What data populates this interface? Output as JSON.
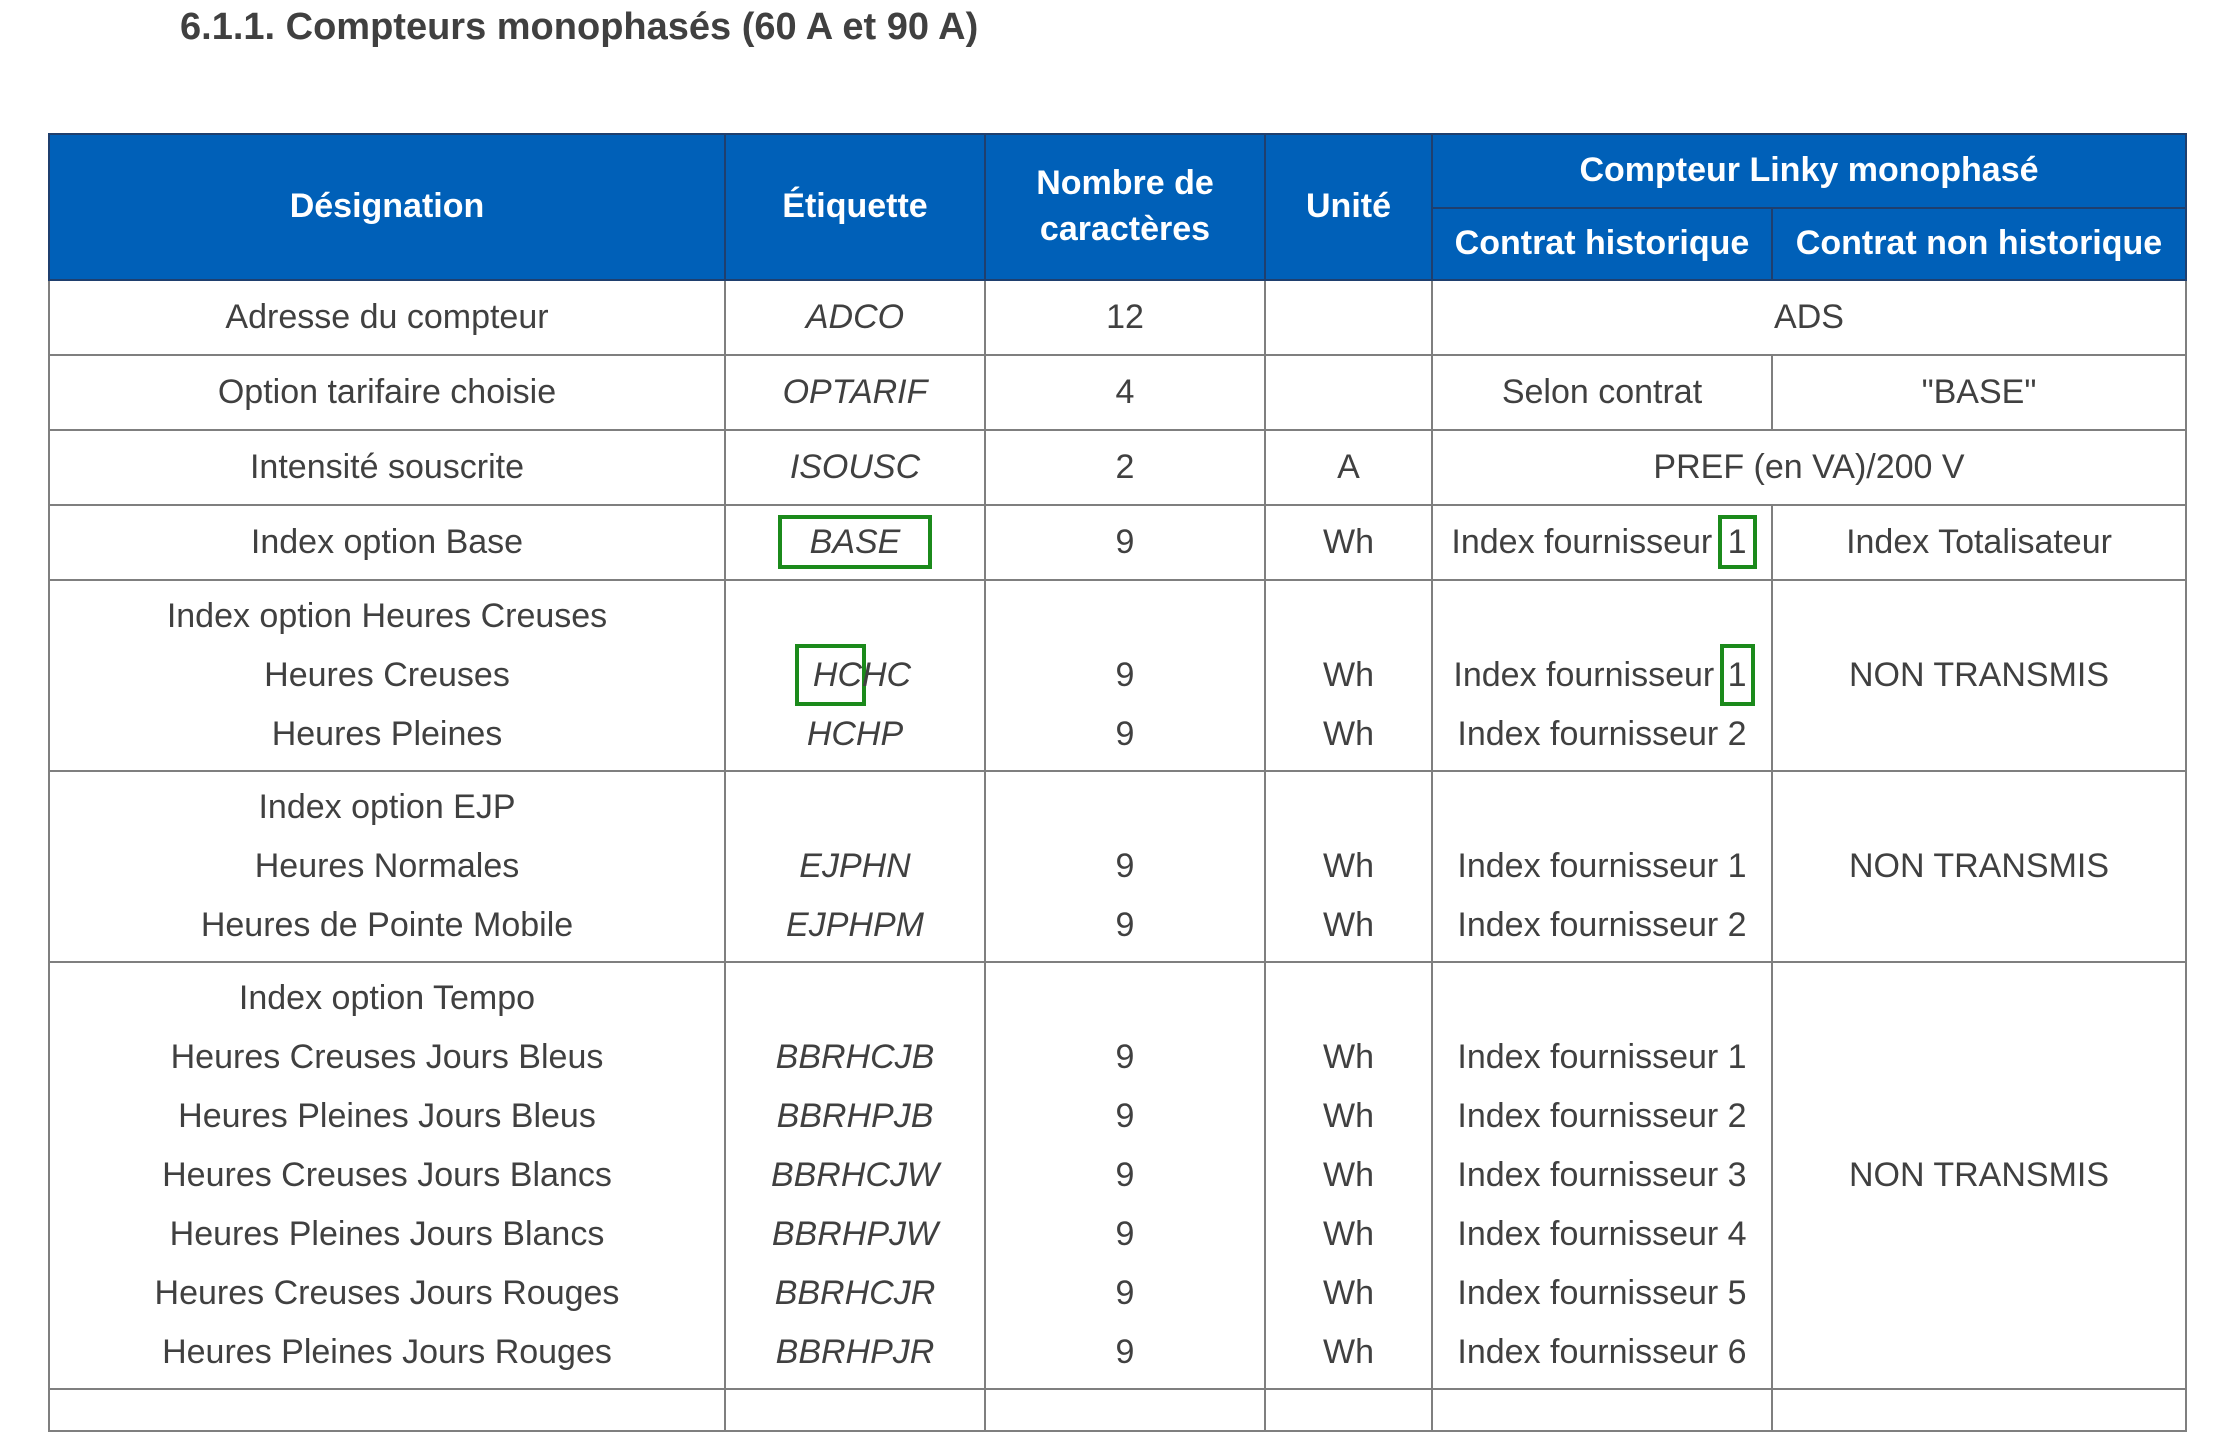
{
  "heading": "6.1.1. Compteurs monophasés (60 A et 90 A)",
  "table": {
    "headers": {
      "designation": "Désignation",
      "etiquette": "Étiquette",
      "nombre": "Nombre de caractères",
      "unite": "Unité",
      "group": "Compteur Linky monophasé",
      "historique": "Contrat historique",
      "non_historique": "Contrat non historique"
    },
    "rows": [
      {
        "designation": "Adresse du compteur",
        "etiquette": "ADCO",
        "nombre": "12",
        "unite": "",
        "merged": "ADS"
      },
      {
        "designation": "Option tarifaire choisie",
        "etiquette": "OPTARIF",
        "nombre": "4",
        "unite": "",
        "historique": "Selon contrat",
        "non_historique": "\"BASE\""
      },
      {
        "designation": "Intensité souscrite",
        "etiquette": "ISOUSC",
        "nombre": "2",
        "unite": "A",
        "merged": "PREF (en VA)/200 V"
      },
      {
        "designation": "Index option Base",
        "etiquette": "BASE",
        "nombre": "9",
        "unite": "Wh",
        "historique": "Index fournisseur 1",
        "non_historique": "Index Totalisateur"
      }
    ],
    "groups": [
      {
        "title": "Index option Heures Creuses",
        "non_historique": "NON TRANSMIS",
        "lines": [
          {
            "designation": "Heures Creuses",
            "etiquette": "HCHC",
            "nombre": "9",
            "unite": "Wh",
            "historique": "Index fournisseur 1"
          },
          {
            "designation": "Heures Pleines",
            "etiquette": "HCHP",
            "nombre": "9",
            "unite": "Wh",
            "historique": "Index fournisseur 2"
          }
        ]
      },
      {
        "title": "Index option EJP",
        "non_historique": "NON TRANSMIS",
        "lines": [
          {
            "designation": "Heures Normales",
            "etiquette": "EJPHN",
            "nombre": "9",
            "unite": "Wh",
            "historique": "Index fournisseur 1"
          },
          {
            "designation": "Heures de Pointe Mobile",
            "etiquette": "EJPHPM",
            "nombre": "9",
            "unite": "Wh",
            "historique": "Index fournisseur 2"
          }
        ]
      },
      {
        "title": "Index option Tempo",
        "non_historique": "NON TRANSMIS",
        "lines": [
          {
            "designation": "Heures Creuses Jours Bleus",
            "etiquette": "BBRHCJB",
            "nombre": "9",
            "unite": "Wh",
            "historique": "Index fournisseur 1"
          },
          {
            "designation": "Heures Pleines Jours Bleus",
            "etiquette": "BBRHPJB",
            "nombre": "9",
            "unite": "Wh",
            "historique": "Index fournisseur 2"
          },
          {
            "designation": "Heures Creuses Jours Blancs",
            "etiquette": "BBRHCJW",
            "nombre": "9",
            "unite": "Wh",
            "historique": "Index fournisseur 3"
          },
          {
            "designation": "Heures Pleines Jours Blancs",
            "etiquette": "BBRHPJW",
            "nombre": "9",
            "unite": "Wh",
            "historique": "Index fournisseur 4"
          },
          {
            "designation": "Heures Creuses Jours Rouges",
            "etiquette": "BBRHCJR",
            "nombre": "9",
            "unite": "Wh",
            "historique": "Index fournisseur 5"
          },
          {
            "designation": "Heures Pleines Jours Rouges",
            "etiquette": "BBRHPJR",
            "nombre": "9",
            "unite": "Wh",
            "historique": "Index fournisseur 6"
          }
        ]
      }
    ]
  },
  "annotation_color": "#1b8a1b"
}
